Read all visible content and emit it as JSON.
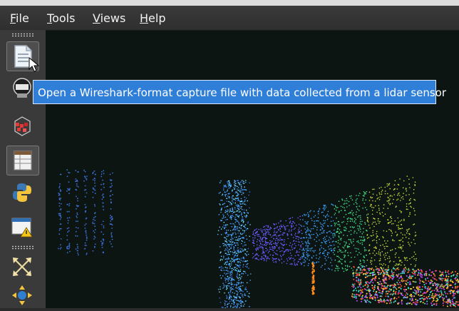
{
  "window": {
    "menu": [
      {
        "label": "File"
      },
      {
        "label": "Tools"
      },
      {
        "label": "Views"
      },
      {
        "label": "Help"
      }
    ]
  },
  "toolbar": {
    "buttons": [
      {
        "icon": "open-file-icon",
        "active": true
      },
      {
        "icon": "connect-sensor-icon"
      },
      {
        "icon": "cube-grid-icon"
      },
      {
        "icon": "spreadsheet-view-icon"
      },
      {
        "icon": "python-icon"
      },
      {
        "icon": "warning-window-icon"
      },
      {
        "icon": "expand-arrows-icon"
      },
      {
        "icon": "move-points-icon"
      }
    ]
  },
  "tooltip": {
    "text": "Open a Wireshark-format capture file with data collected from a lidar sensor"
  },
  "colors": {
    "background": "#0d1512",
    "tooltip": "#2f7ed8",
    "menubar": "#333333"
  }
}
